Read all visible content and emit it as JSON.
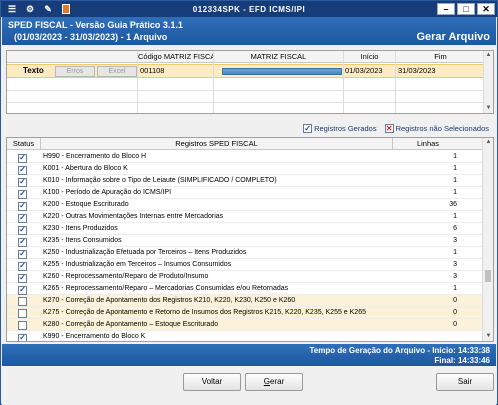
{
  "window": {
    "title": "012334SPK - EFD ICMS/IPI",
    "icons": [
      "app-menu-icon",
      "settings-icon",
      "tools-icon",
      "book-icon"
    ],
    "controls": {
      "minimize": "–",
      "maximize": "□",
      "close": "✕"
    }
  },
  "header": {
    "title": "SPED FISCAL - Versão Guia Prático 3.1.1",
    "subtitle": "(01/03/2023 - 31/03/2023) - 1 Arquivo",
    "action": "Gerar Arquivo"
  },
  "top_grid": {
    "columns": [
      "Código MATRIZ FISCAL",
      "MATRIZ FISCAL",
      "Início",
      "Fim"
    ],
    "row": {
      "label": "Texto",
      "btn_erros": "Erros",
      "btn_excel": "Excel",
      "codigo": "001108",
      "matriz": "",
      "inicio": "01/03/2023",
      "fim": "31/03/2023"
    }
  },
  "legend": {
    "gerados": "Registros Gerados",
    "nao_selecionados": "Registros não Selecionados",
    "colors": {
      "gerado": "#1a4fb3",
      "nao": "#d41e1e"
    }
  },
  "main_grid": {
    "columns": {
      "status": "Status",
      "registros": "Registros SPED FISCAL",
      "linhas": "Linhas"
    },
    "rows": [
      {
        "checked": true,
        "desc": "H990 - Encerramento do Bloco H",
        "lines": "1"
      },
      {
        "checked": true,
        "desc": "K001 - Abertura do Bloco K",
        "lines": "1"
      },
      {
        "checked": true,
        "desc": "K010 - Informação sobre o Tipo de Leiaute (SIMPLIFICADO / COMPLETO)",
        "lines": "1"
      },
      {
        "checked": true,
        "desc": "K100 - Período de Apuração do ICMS/IPI",
        "lines": "1"
      },
      {
        "checked": true,
        "desc": "K200 - Estoque Escriturado",
        "lines": "36"
      },
      {
        "checked": true,
        "desc": "K220 - Outras Movimentações Internas entre Mercadorias",
        "lines": "1"
      },
      {
        "checked": true,
        "desc": "K230 - Itens Produzidos",
        "lines": "6"
      },
      {
        "checked": true,
        "desc": "K235 - Itens Consumidos",
        "lines": "3"
      },
      {
        "checked": true,
        "desc": "K250 - Industrialização Efetuada por Terceiros – Itens Produzidos",
        "lines": "1"
      },
      {
        "checked": true,
        "desc": "K255 - Industrialização em Terceiros – Insumos Consumidos",
        "lines": "3"
      },
      {
        "checked": true,
        "desc": "K260 - Reprocessamento/Reparo de Produto/Insumo",
        "lines": "3"
      },
      {
        "checked": true,
        "desc": "K265 - Reprocessamento/Reparo – Mercadorias Consumidas e/ou Retornadas",
        "lines": "1"
      },
      {
        "checked": false,
        "desc": "K270 - Correção de Apontamento dos Registros K210, K220, K230, K250 e K260",
        "lines": "0"
      },
      {
        "checked": false,
        "desc": "K275 - Correção de Apontamento e Retorno de Insumos dos Registros K215, K220, K235, K255 e K265",
        "lines": "0"
      },
      {
        "checked": false,
        "desc": "K280 - Correção de Apontamento – Estoque Escriturado",
        "lines": "0"
      },
      {
        "checked": true,
        "desc": "K990 - Encerramento do Bloco K",
        "lines": ""
      }
    ]
  },
  "status": {
    "line1": "Tempo de Geração do Arquivo - Início: 14:33:38",
    "line2": "Final: 14:33:46"
  },
  "footer": {
    "voltar": "Voltar",
    "gerar": "Gerar",
    "sair": "Sair"
  }
}
